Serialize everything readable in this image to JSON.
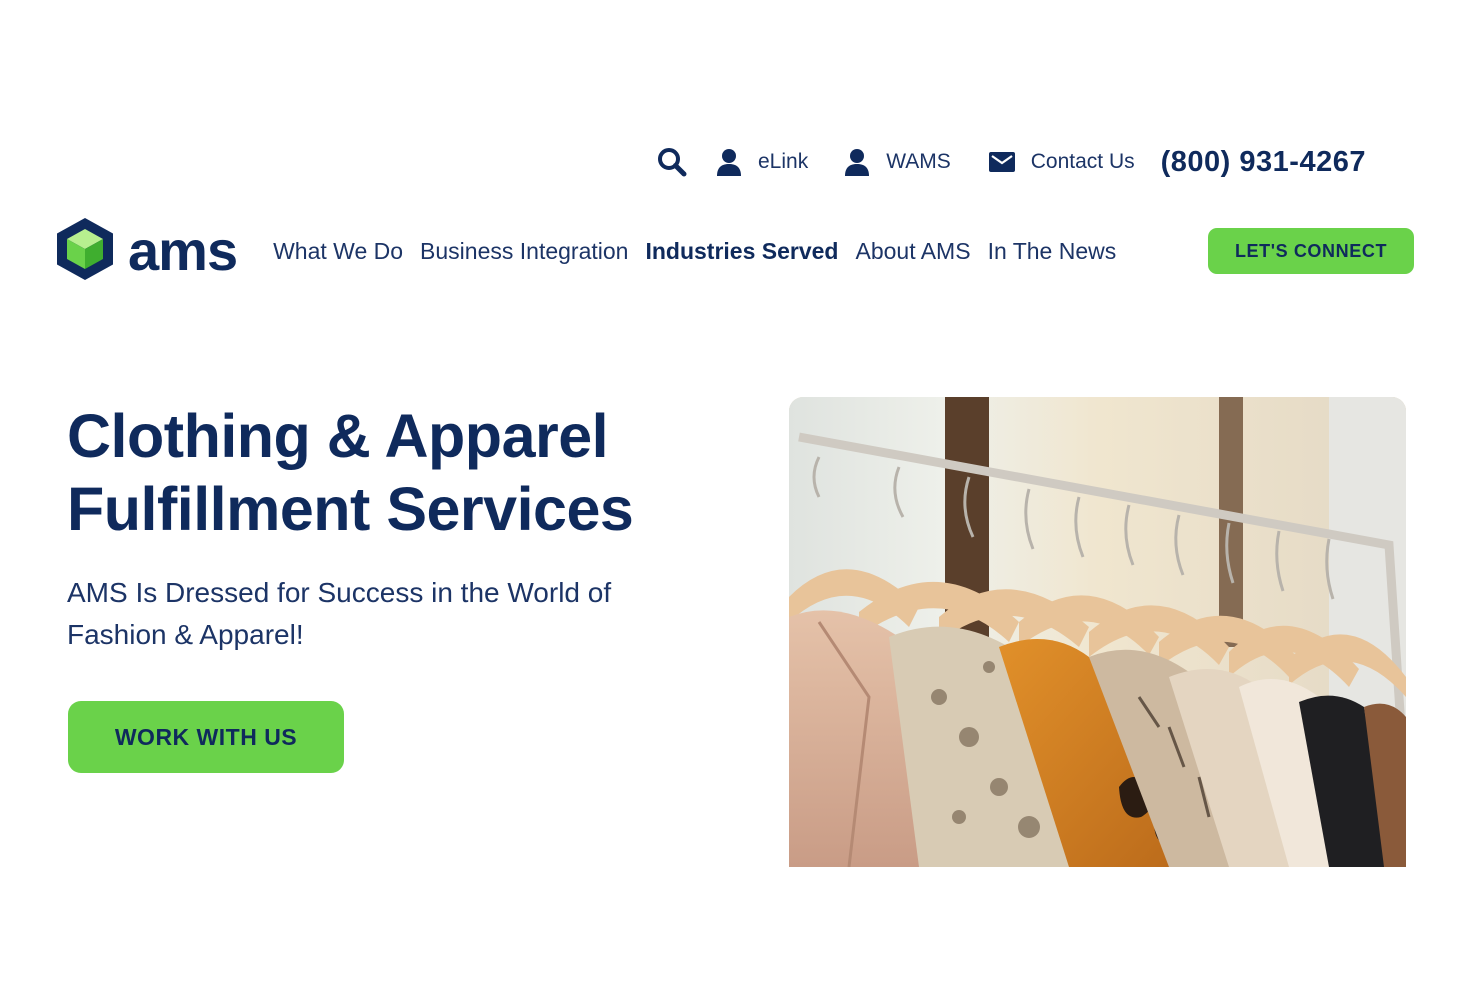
{
  "utility_bar": {
    "elink_label": "eLink",
    "wams_label": "WAMS",
    "contact_label": "Contact Us",
    "phone": "(800) 931-4267",
    "icons": [
      "search-icon",
      "user-icon",
      "user-icon",
      "mail-icon"
    ]
  },
  "nav": {
    "logo_text": "ams",
    "links": [
      {
        "label": "What We Do",
        "active": false
      },
      {
        "label": "Business Integration",
        "active": false
      },
      {
        "label": "Industries Served",
        "active": true
      },
      {
        "label": "About AMS",
        "active": false
      },
      {
        "label": "In The News",
        "active": false
      }
    ],
    "cta_label": "LET'S CONNECT"
  },
  "hero": {
    "title_line1": "Clothing & Apparel",
    "title_line2": "Fulfillment Services",
    "subtitle_line1": "AMS Is Dressed for Success in the World of",
    "subtitle_line2": "Fashion & Apparel!",
    "button_label": "WORK WITH US"
  },
  "colors": {
    "brand_navy": "#0f2a5c",
    "accent_green": "#6ad24a",
    "background": "#ffffff"
  }
}
